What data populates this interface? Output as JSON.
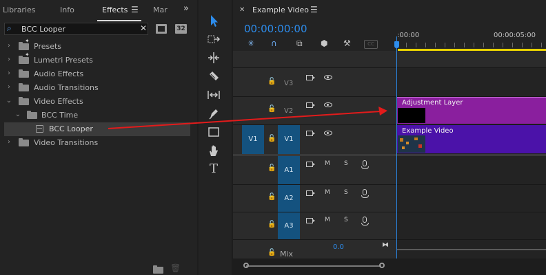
{
  "effects_panel": {
    "tabs": [
      {
        "label": "Libraries",
        "active": false
      },
      {
        "label": "Info",
        "active": false
      },
      {
        "label": "Effects",
        "active": true
      },
      {
        "label": "Mar",
        "active": false
      }
    ],
    "menu_icon": "hamburger-menu-icon",
    "overflow_icon": "double-chevron-right-icon",
    "search": {
      "value": "BCC Looper"
    },
    "badges": [
      "32"
    ],
    "tree": [
      {
        "label": "Presets",
        "indent": 0,
        "expanded": false,
        "icon": "preset-folder-icon"
      },
      {
        "label": "Lumetri Presets",
        "indent": 0,
        "expanded": false,
        "icon": "preset-folder-icon"
      },
      {
        "label": "Audio Effects",
        "indent": 0,
        "expanded": false,
        "icon": "folder-icon"
      },
      {
        "label": "Audio Transitions",
        "indent": 0,
        "expanded": false,
        "icon": "folder-icon"
      },
      {
        "label": "Video Effects",
        "indent": 0,
        "expanded": true,
        "icon": "folder-icon"
      },
      {
        "label": "BCC Time",
        "indent": 1,
        "expanded": true,
        "icon": "folder-icon"
      },
      {
        "label": "BCC Looper",
        "indent": 2,
        "expanded": null,
        "icon": "effect-icon",
        "selected": true
      },
      {
        "label": "Video Transitions",
        "indent": 0,
        "expanded": false,
        "icon": "folder-icon"
      }
    ]
  },
  "tools": [
    "selection-tool-icon",
    "track-select-forward-icon",
    "ripple-edit-icon",
    "razor-icon",
    "slip-icon",
    "pen-icon",
    "rectangle-icon",
    "hand-icon",
    "type-icon"
  ],
  "timeline": {
    "title": "Example Video",
    "timecode": "00:00:00:00",
    "ruler_labels": [
      ":00:00",
      "00:00:05:00"
    ],
    "video_tracks": [
      {
        "name": "V3",
        "source_patch": ""
      },
      {
        "name": "V2",
        "source_patch": ""
      },
      {
        "name": "V1",
        "source_patch": "V1"
      }
    ],
    "audio_tracks": [
      {
        "name": "A1",
        "m": "M",
        "s": "S"
      },
      {
        "name": "A2",
        "m": "M",
        "s": "S"
      },
      {
        "name": "A3",
        "m": "M",
        "s": "S"
      }
    ],
    "mix": {
      "label": "Mix",
      "value": "0.0"
    },
    "clips": [
      {
        "label": "Adjustment Layer",
        "track": "V2",
        "color": "#8a1f9e"
      },
      {
        "label": "Example Video",
        "track": "V1",
        "color": "#4b12a9"
      }
    ]
  },
  "colors": {
    "accent_blue": "#2d8ceb",
    "playhead": "#2d8ceb",
    "annotation_arrow": "#e31b1b",
    "track_target": "#14527f",
    "work_area": "#e8d200"
  }
}
